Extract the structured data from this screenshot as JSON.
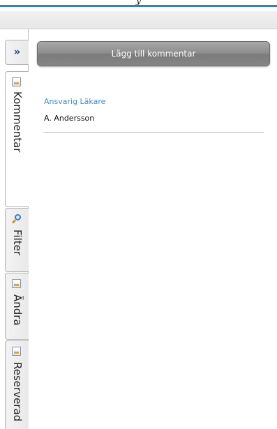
{
  "window": {
    "title_fragment": "y"
  },
  "side_tabs": {
    "collapse_glyph": "»",
    "items": [
      {
        "label": "Kommentar",
        "icon": "document-icon",
        "active": true
      },
      {
        "label": "Filter",
        "icon": "magnifier-icon",
        "active": false
      },
      {
        "label": "Ändra",
        "icon": "document-icon",
        "active": false
      },
      {
        "label": "Reserverad",
        "icon": "document-icon",
        "active": false
      }
    ]
  },
  "panel": {
    "add_comment_label": "Lägg till kommentar",
    "responsible_label": "Ansvarig Läkare",
    "responsible_value": "A. Andersson"
  },
  "colors": {
    "accent": "#2f81c2",
    "label_blue": "#3a8fd6",
    "button_gray": "#8d8d8d"
  }
}
